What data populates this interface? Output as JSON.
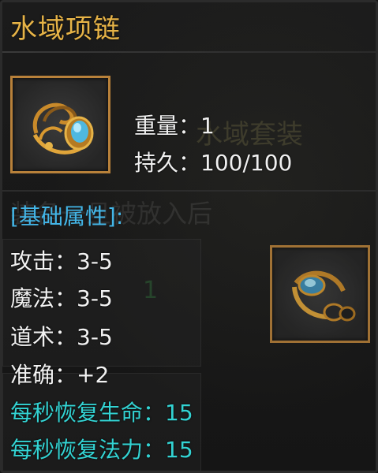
{
  "item": {
    "name": "水域项链",
    "weight_label": "重量",
    "weight_value": "1",
    "durability_label": "持久",
    "durability_value": "100/100"
  },
  "background": {
    "set_name": "水域套装",
    "desc_fragment": "装备一旦被放入后",
    "number_one": "1"
  },
  "sections": {
    "basic_header": "[基础属性]:"
  },
  "attributes": [
    {
      "label": "攻击",
      "value": "3-5"
    },
    {
      "label": "魔法",
      "value": "3-5"
    },
    {
      "label": "道术",
      "value": "3-5"
    },
    {
      "label": "准确",
      "value": "+2"
    },
    {
      "label": "每秒恢复生命",
      "value": "15"
    },
    {
      "label": "每秒恢复法力",
      "value": "15"
    }
  ],
  "icons": {
    "main": "necklace-icon",
    "side": "necklace-icon"
  },
  "colors": {
    "title": "#e6b347",
    "section_header": "#43b6e8",
    "cyan_stat": "#33d3d3",
    "slot_border": "#b8813a",
    "text": "#f0f0f0"
  }
}
